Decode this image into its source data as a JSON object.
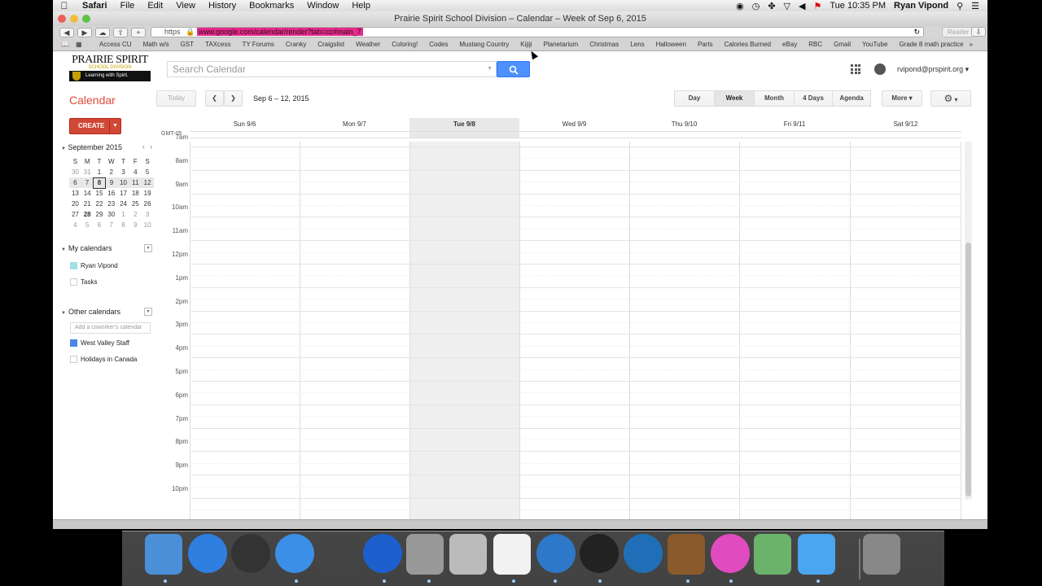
{
  "menubar": {
    "app": "Safari",
    "items": [
      "File",
      "Edit",
      "View",
      "History",
      "Bookmarks",
      "Window",
      "Help"
    ],
    "clock": "Tue 10:35 PM",
    "user": "Ryan Vipond"
  },
  "window": {
    "title": "Prairie Spirit School Division – Calendar – Week of Sep 6, 2015"
  },
  "toolbar": {
    "https": "https",
    "url": "www.google.com/calendar/render?tab=cc#main_7",
    "reader": "Reader"
  },
  "bookmarks": [
    "Access CU",
    "Math w/s",
    "GST",
    "TAXcess",
    "TY Forums",
    "Cranky",
    "Craigslist",
    "Weather",
    "Coloring!",
    "Codes",
    "Mustang Country",
    "Kijiji",
    "Planetarium",
    "Christmas",
    "Lens",
    "Halloween",
    "Parts",
    "Calories Burned",
    "eBay",
    "RBC",
    "Gmail",
    "YouTube",
    "Grade 8 math practice"
  ],
  "logo": {
    "line1": "PRAIRIE SPIRIT",
    "line2": "SCHOOL DIVISION",
    "tagline": "Learning with Spirit."
  },
  "search": {
    "placeholder": "Search Calendar"
  },
  "account": {
    "email": "rvipond@prspirit.org ▾"
  },
  "calendar": {
    "title": "Calendar",
    "today": "Today",
    "range": "Sep 6 – 12, 2015",
    "views": [
      "Day",
      "Week",
      "Month",
      "4 Days",
      "Agenda"
    ],
    "selected_view": "Week",
    "more": "More ▾",
    "gmt": "GMT-05",
    "days": [
      "Sun 9/6",
      "Mon 9/7",
      "Tue 9/8",
      "Wed 9/9",
      "Thu 9/10",
      "Fri 9/11",
      "Sat 9/12"
    ],
    "current_day_index": 2,
    "hours": [
      "7am",
      "8am",
      "9am",
      "10am",
      "11am",
      "12pm",
      "1pm",
      "2pm",
      "3pm",
      "4pm",
      "5pm",
      "6pm",
      "7pm",
      "8pm",
      "9pm",
      "10pm"
    ]
  },
  "sidebar": {
    "create": "CREATE",
    "mini_month": "September 2015",
    "weekdays": [
      "S",
      "M",
      "T",
      "W",
      "T",
      "F",
      "S"
    ],
    "weeks": [
      [
        "30",
        "31",
        "1",
        "2",
        "3",
        "4",
        "5"
      ],
      [
        "6",
        "7",
        "8",
        "9",
        "10",
        "11",
        "12"
      ],
      [
        "13",
        "14",
        "15",
        "16",
        "17",
        "18",
        "19"
      ],
      [
        "20",
        "21",
        "22",
        "23",
        "24",
        "25",
        "26"
      ],
      [
        "27",
        "28",
        "29",
        "30",
        "1",
        "2",
        "3"
      ],
      [
        "4",
        "5",
        "6",
        "7",
        "8",
        "9",
        "10"
      ]
    ],
    "my_calendars": "My calendars",
    "my_items": [
      {
        "label": "Ryan Vipond",
        "color": "#9fe1e7"
      },
      {
        "label": "Tasks",
        "color": "#ffffff"
      }
    ],
    "other_calendars": "Other calendars",
    "coworker_placeholder": "Add a coworker's calendar",
    "other_items": [
      {
        "label": "West Valley Staff",
        "color": "#4986e7"
      },
      {
        "label": "Holidays in Canada",
        "color": "#ffffff"
      }
    ]
  },
  "colors": {
    "accent": "#dd4b39",
    "create": "#d14836",
    "search_button": "#4d90fe"
  },
  "dock": [
    "finder",
    "app-store",
    "dashboard",
    "safari",
    "script-editor",
    "google-earth",
    "preview",
    "calculator",
    "acrobat-reader",
    "network",
    "plex",
    "quicktime",
    "iphoto",
    "itunes",
    "maps",
    "messages",
    "trash"
  ]
}
